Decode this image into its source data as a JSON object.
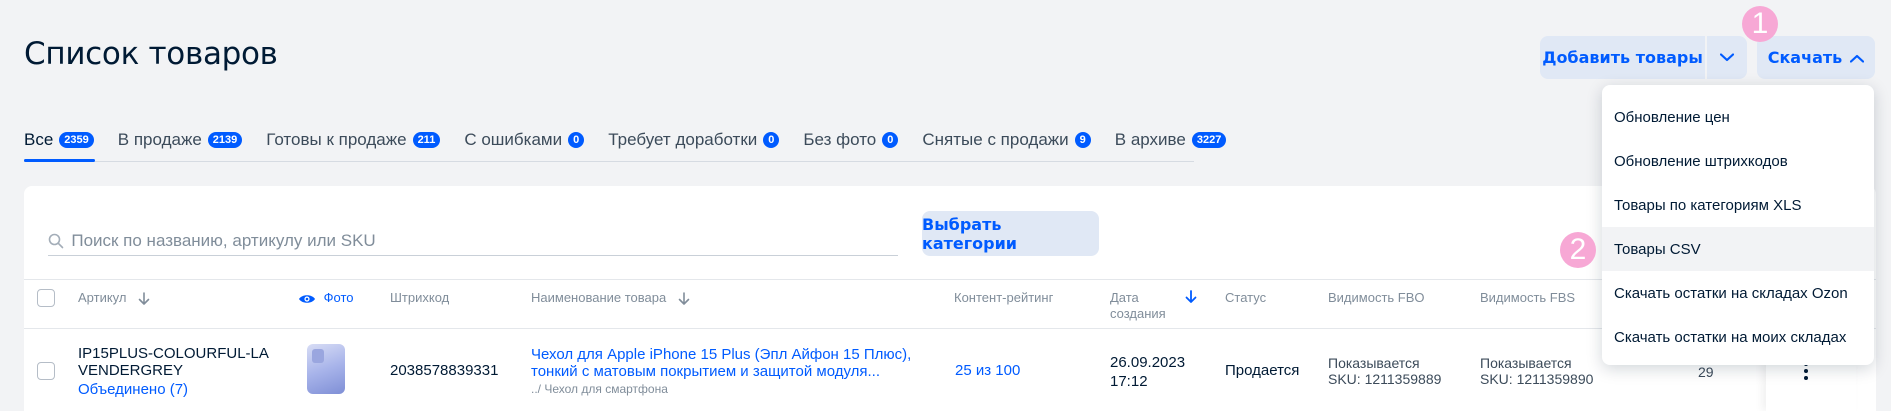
{
  "header": {
    "title": "Список товаров",
    "add_label": "Добавить товары",
    "download_label": "Скачать"
  },
  "tabs": [
    {
      "label": "Все",
      "count": "2359"
    },
    {
      "label": "В продаже",
      "count": "2139"
    },
    {
      "label": "Готовы к продаже",
      "count": "211"
    },
    {
      "label": "С ошибками",
      "count": "0"
    },
    {
      "label": "Требует доработки",
      "count": "0"
    },
    {
      "label": "Без фото",
      "count": "0"
    },
    {
      "label": "Снятые с продажи",
      "count": "9"
    },
    {
      "label": "В архиве",
      "count": "3227"
    }
  ],
  "search": {
    "placeholder": "Поиск по названию, артикулу или SKU"
  },
  "filters": {
    "category_label": "Выбрать категории"
  },
  "table": {
    "columns": {
      "article": "Артикул",
      "photo": "Фото",
      "barcode": "Штрихкод",
      "name": "Наименование товара",
      "rating": "Контент-рейтинг",
      "date_line1": "Дата",
      "date_line2": "создания",
      "status": "Статус",
      "fbo": "Видимость FBO",
      "fbs": "Видимость FBS"
    },
    "rows": [
      {
        "article_line1": "IP15PLUS-COLOURFUL-LA",
        "article_line2": "VENDERGREY",
        "merged": "Объединено (7)",
        "barcode": "2038578839331",
        "name_line1": "Чехол для Apple iPhone 15 Plus (Эпл Айфон 15 Плюс),",
        "name_line2": "тонкий с матовым покрытием и защитой модуля...",
        "category": "../ Чехол для смартфона",
        "rating": "25 из 100",
        "date": "26.09.2023",
        "time": "17:12",
        "status": "Продается",
        "fbo_status": "Показывается",
        "fbo_sku": "SKU: 1211359889",
        "fbs_status": "Показывается",
        "fbs_sku": "SKU: 1211359890",
        "stock": "29"
      }
    ]
  },
  "download_menu": {
    "items": [
      "Обновление цен",
      "Обновление штрихкодов",
      "Товары по категориям XLS",
      "Товары CSV",
      "Скачать остатки на складах Ozon",
      "Скачать остатки на моих складах"
    ]
  },
  "markers": [
    "1",
    "2"
  ],
  "colors": {
    "accent": "#005bff",
    "button_bg": "#e0e8f5",
    "marker": "#f7a8d5"
  }
}
